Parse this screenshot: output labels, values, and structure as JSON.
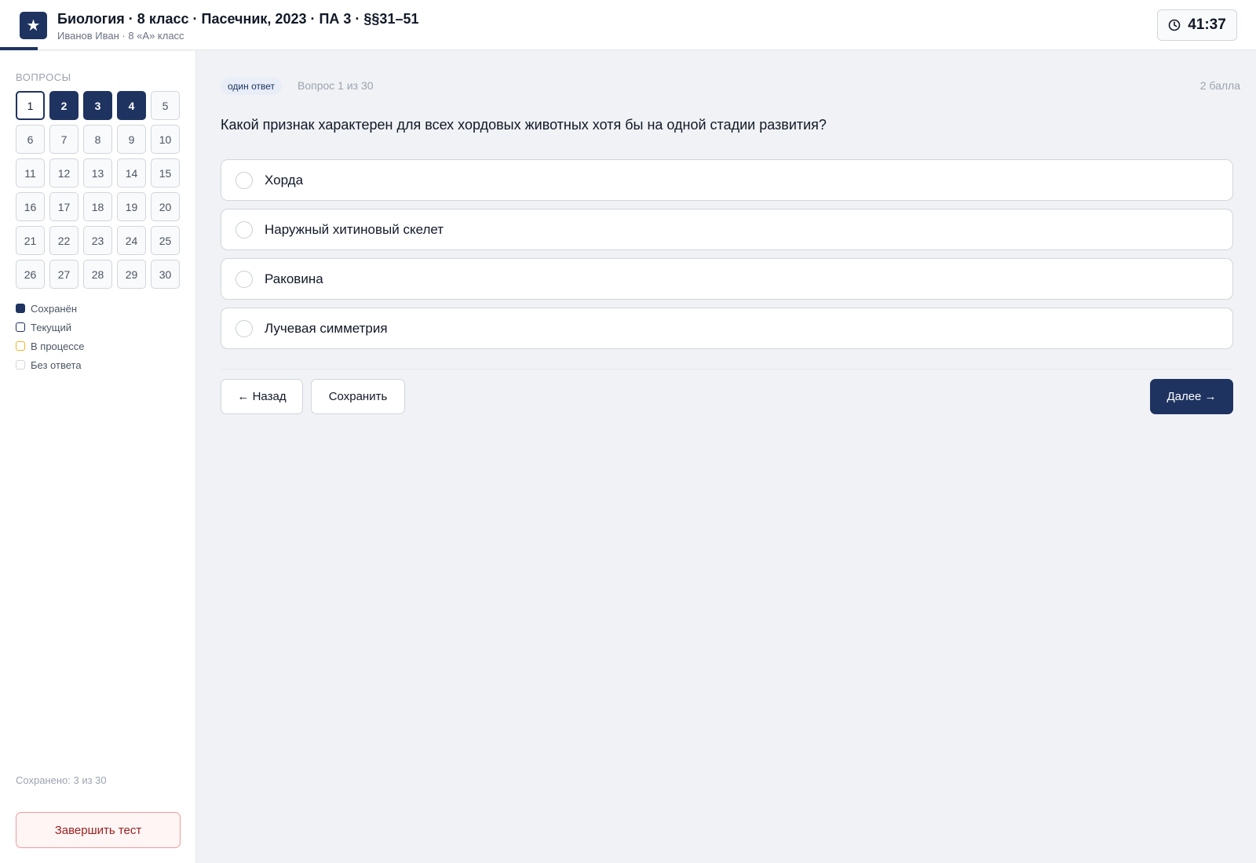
{
  "header": {
    "title": "Биология · 8 класс · Пасечник, 2023 · ПА 3 · §§31–51",
    "subtitle": "Иванов Иван · 8 «А» класс",
    "timer": "41:37"
  },
  "sidebar": {
    "heading": "ВОПРОСЫ",
    "questions": [
      {
        "n": "1",
        "state": "current"
      },
      {
        "n": "2",
        "state": "saved"
      },
      {
        "n": "3",
        "state": "saved"
      },
      {
        "n": "4",
        "state": "saved"
      },
      {
        "n": "5",
        "state": "none"
      },
      {
        "n": "6",
        "state": "none"
      },
      {
        "n": "7",
        "state": "none"
      },
      {
        "n": "8",
        "state": "none"
      },
      {
        "n": "9",
        "state": "none"
      },
      {
        "n": "10",
        "state": "none"
      },
      {
        "n": "11",
        "state": "none"
      },
      {
        "n": "12",
        "state": "none"
      },
      {
        "n": "13",
        "state": "none"
      },
      {
        "n": "14",
        "state": "none"
      },
      {
        "n": "15",
        "state": "none"
      },
      {
        "n": "16",
        "state": "none"
      },
      {
        "n": "17",
        "state": "none"
      },
      {
        "n": "18",
        "state": "none"
      },
      {
        "n": "19",
        "state": "none"
      },
      {
        "n": "20",
        "state": "none"
      },
      {
        "n": "21",
        "state": "none"
      },
      {
        "n": "22",
        "state": "none"
      },
      {
        "n": "23",
        "state": "none"
      },
      {
        "n": "24",
        "state": "none"
      },
      {
        "n": "25",
        "state": "none"
      },
      {
        "n": "26",
        "state": "none"
      },
      {
        "n": "27",
        "state": "none"
      },
      {
        "n": "28",
        "state": "none"
      },
      {
        "n": "29",
        "state": "none"
      },
      {
        "n": "30",
        "state": "none"
      }
    ],
    "legend": [
      {
        "label": "Сохранён",
        "kind": "saved"
      },
      {
        "label": "Текущий",
        "kind": "current"
      },
      {
        "label": "В процессе",
        "kind": "progress"
      },
      {
        "label": "Без ответа",
        "kind": "none"
      }
    ],
    "saved_count": "Сохранено: 3 из 30",
    "finish_label": "Завершить тест"
  },
  "main": {
    "type_badge": "один ответ",
    "counter": "Вопрос 1 из 30",
    "points": "2 балла",
    "question": "Какой признак характерен для всех хордовых животных хотя бы на одной стадии развития?",
    "options": [
      "Хорда",
      "Наружный хитиновый скелет",
      "Раковина",
      "Лучевая симметрия"
    ],
    "back_label": "← Назад",
    "save_label": "Сохранить",
    "next_label": "Далее →"
  },
  "colors": {
    "accent": "#1e3360",
    "in_progress": "#f0b429",
    "danger": "#9b1c1c"
  },
  "icons": {
    "logo": "star-icon",
    "timer": "clock-icon"
  }
}
